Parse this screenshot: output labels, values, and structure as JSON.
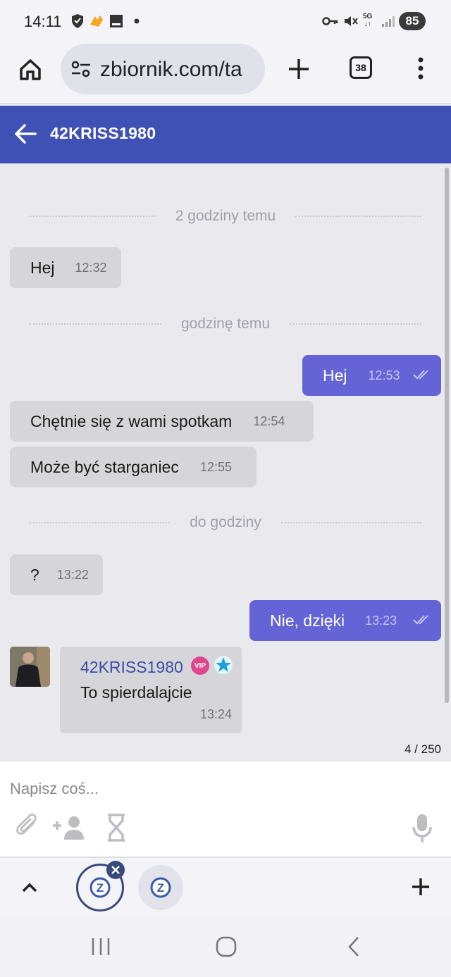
{
  "status_bar": {
    "time": "14:11",
    "battery": "85",
    "network": "5G"
  },
  "browser": {
    "url": "zbiornik.com/ta",
    "tab_count": "38"
  },
  "chat": {
    "title": "42KRISS1980"
  },
  "separators": [
    "2 godziny temu",
    "godzinę temu",
    "do godziny"
  ],
  "messages": [
    {
      "direction": "in",
      "text": "Hej",
      "time": "12:32"
    },
    {
      "direction": "out",
      "text": "Hej",
      "time": "12:53"
    },
    {
      "direction": "in",
      "text": "Chętnie się z wami spotkam",
      "time": "12:54"
    },
    {
      "direction": "in",
      "text": "Może być starganiec",
      "time": "12:55"
    },
    {
      "direction": "in",
      "text": "?",
      "time": "13:22"
    },
    {
      "direction": "out",
      "text": "Nie, dzięki",
      "time": "13:23"
    }
  ],
  "last_message": {
    "sender": "42KRISS1980",
    "badge": "VIP",
    "text": "To spierdalajcie",
    "time": "13:24"
  },
  "char_counter": "4 / 250",
  "composer": {
    "placeholder": "Napisz coś..."
  },
  "colors": {
    "header": "#3f51b5",
    "outgoing_bubble": "#6464d6",
    "incoming_bubble": "#d6d6da"
  }
}
